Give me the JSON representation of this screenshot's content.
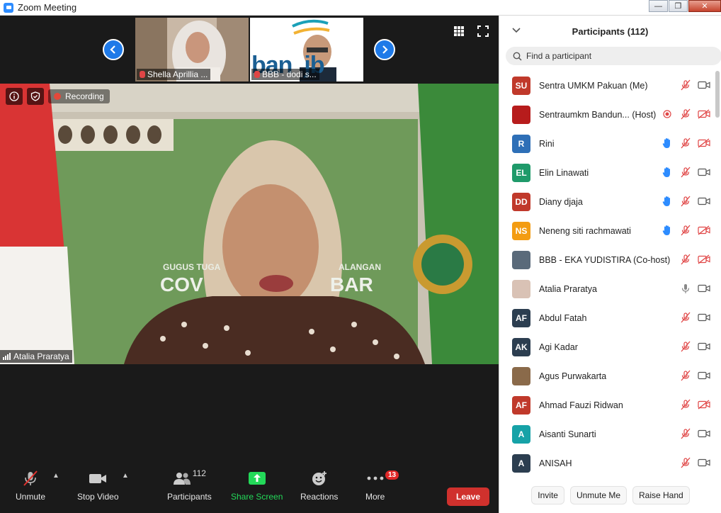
{
  "window": {
    "title": "Zoom Meeting",
    "controls": [
      "—",
      "❐",
      "✕"
    ]
  },
  "thumbnails": [
    {
      "name": "Shella Aprillia ..."
    },
    {
      "name": "BBB - dodi s...",
      "logo_text": "ban  jb"
    }
  ],
  "recording": {
    "label": "Recording"
  },
  "main_video": {
    "speaker": "Atalia Praratya",
    "banner_line1": "GUGUS TUGA",
    "banner_line1b": "ALANGAN",
    "banner_line2": "COV",
    "banner_line2b": "BAR"
  },
  "toolbar": {
    "unmute": "Unmute",
    "stop_video": "Stop Video",
    "participants": "Participants",
    "participants_count": "112",
    "share_screen": "Share Screen",
    "reactions": "Reactions",
    "more": "More",
    "more_badge": "13",
    "leave": "Leave",
    "share_color": "#23d959",
    "leave_color": "#d0312d"
  },
  "panel": {
    "title": "Participants (112)",
    "search_placeholder": "Find a participant",
    "participants": [
      {
        "initials": "SU",
        "name": "Sentra UMKM Pakuan (Me)",
        "color": "#c0392b",
        "hand": false,
        "video_off": false,
        "recording": false
      },
      {
        "initials": "",
        "name": "Sentraumkm Bandun...  (Host)",
        "color": "#b71c1c",
        "hand": false,
        "video_off": true,
        "recording": true
      },
      {
        "initials": "R",
        "name": "Rini",
        "color": "#2e6fb7",
        "hand": true,
        "video_off": true,
        "recording": false
      },
      {
        "initials": "EL",
        "name": "Elin Linawati",
        "color": "#1f9a6a",
        "hand": true,
        "video_off": false,
        "recording": false
      },
      {
        "initials": "DD",
        "name": "Diany djaja",
        "color": "#c0392b",
        "hand": true,
        "video_off": false,
        "recording": false
      },
      {
        "initials": "NS",
        "name": "Neneng siti rachmawati",
        "color": "#f39c12",
        "hand": true,
        "video_off": true,
        "recording": false
      },
      {
        "initials": "",
        "name": "BBB - EKA YUDISTIRA (Co-host)",
        "color": "#5a6a7a",
        "hand": false,
        "video_off": true,
        "recording": false
      },
      {
        "initials": "",
        "name": "Atalia Praratya",
        "color": "#d9c2b5",
        "hand": false,
        "video_off": false,
        "recording": false,
        "mic_on": true
      },
      {
        "initials": "AF",
        "name": "Abdul Fatah",
        "color": "#2c3e50",
        "hand": false,
        "video_off": false,
        "recording": false
      },
      {
        "initials": "AK",
        "name": "Agi Kadar",
        "color": "#2c3e50",
        "hand": false,
        "video_off": false,
        "recording": false
      },
      {
        "initials": "",
        "name": "Agus Purwakarta",
        "color": "#8a6a4a",
        "hand": false,
        "video_off": false,
        "recording": false
      },
      {
        "initials": "AF",
        "name": "Ahmad Fauzi Ridwan",
        "color": "#c0392b",
        "hand": false,
        "video_off": true,
        "recording": false
      },
      {
        "initials": "A",
        "name": "Aisanti Sunarti",
        "color": "#16a2a7",
        "hand": false,
        "video_off": false,
        "recording": false
      },
      {
        "initials": "A",
        "name": "ANISAH",
        "color": "#2c3e50",
        "hand": false,
        "video_off": false,
        "recording": false
      }
    ],
    "footer": {
      "invite": "Invite",
      "unmute_me": "Unmute Me",
      "raise_hand": "Raise Hand"
    }
  }
}
